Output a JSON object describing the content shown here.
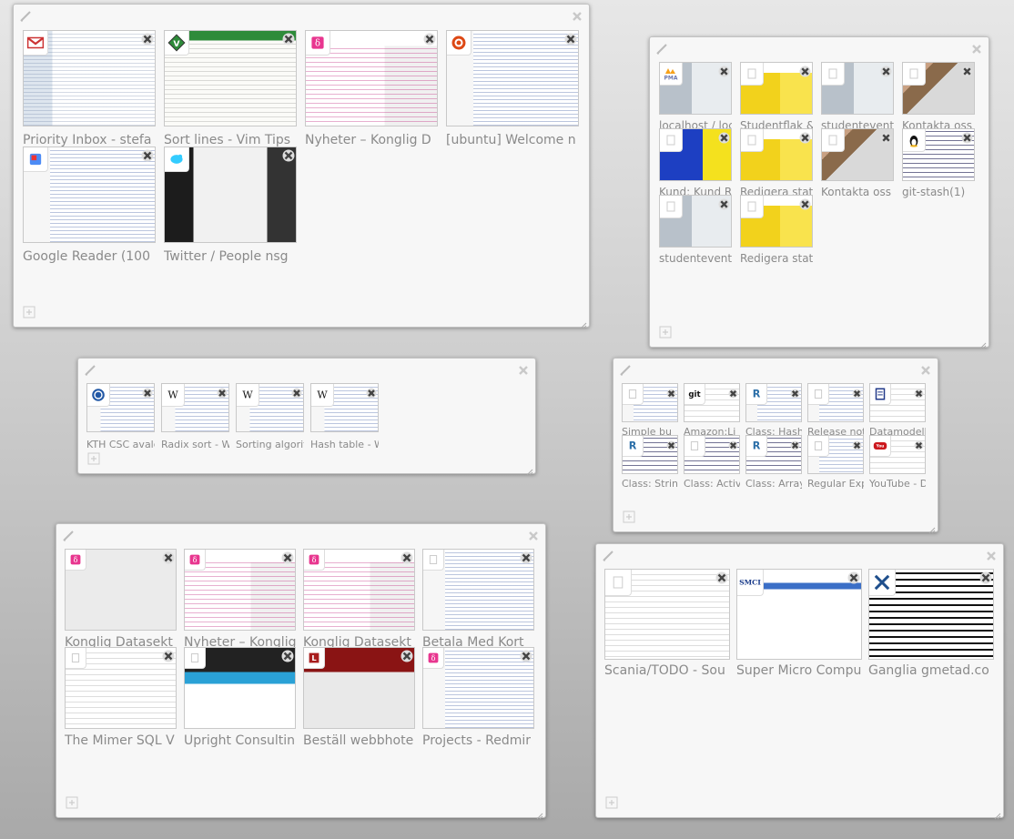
{
  "groups": [
    {
      "id": "group1",
      "tabs": [
        {
          "title": "Priority Inbox - stefa",
          "icon": "gmail-icon",
          "page": "p-table"
        },
        {
          "title": "Sort lines - Vim Tips",
          "icon": "vim-icon",
          "page": "p-green"
        },
        {
          "title": "Nyheter – Konglig D",
          "icon": "datasektionen-icon",
          "page": "p-news"
        },
        {
          "title": "[ubuntu] Welcome n",
          "icon": "ubuntu-icon",
          "page": "p-wiki"
        },
        {
          "title": "Google Reader (100",
          "icon": "google-reader-icon",
          "page": "p-wiki"
        },
        {
          "title": "Twitter / People nsg",
          "icon": "twitter-icon",
          "page": "p-dark"
        }
      ]
    },
    {
      "id": "group2",
      "tabs": [
        {
          "title": "localhost / loca",
          "icon": "phpmyadmin-icon",
          "page": "p-grey"
        },
        {
          "title": "Studentflak & ",
          "icon": "blank-icon",
          "page": "p-yellow"
        },
        {
          "title": "studentevent",
          "icon": "blank-icon",
          "page": "p-grey"
        },
        {
          "title": "Kontakta oss",
          "icon": "blank-icon",
          "page": "p-photo"
        },
        {
          "title": "Kund: Kund R",
          "icon": "blank-icon",
          "page": "p-blueyel"
        },
        {
          "title": "Redigera statu",
          "icon": "blank-icon",
          "page": "p-yellow"
        },
        {
          "title": "Kontakta oss - ",
          "icon": "blank-icon",
          "page": "p-photo"
        },
        {
          "title": "git-stash(1)",
          "icon": "linux-penguin-icon",
          "page": "p-code"
        },
        {
          "title": "studentevent",
          "icon": "blank-icon",
          "page": "p-grey"
        },
        {
          "title": "Redigera statu",
          "icon": "blank-icon",
          "page": "p-yellow"
        }
      ]
    },
    {
      "id": "group3",
      "tabs": [
        {
          "title": "KTH CSC avalc",
          "icon": "kth-icon",
          "page": "p-wiki"
        },
        {
          "title": "Radix sort - Wi",
          "icon": "wikipedia-icon",
          "page": "p-wiki"
        },
        {
          "title": "Sorting algorit",
          "icon": "wikipedia-icon",
          "page": "p-wiki"
        },
        {
          "title": "Hash table - W",
          "icon": "wikipedia-icon",
          "page": "p-wiki"
        }
      ]
    },
    {
      "id": "group4",
      "tabs": [
        {
          "title": "Simple bu",
          "icon": "blank-icon",
          "page": "p-wiki"
        },
        {
          "title": "Amazon:Li",
          "icon": "git-icon",
          "page": "p-plain"
        },
        {
          "title": "Class: Hash",
          "icon": "ruby-doc-icon",
          "page": "p-wiki"
        },
        {
          "title": "Release not",
          "icon": "blank-icon",
          "page": "p-wiki"
        },
        {
          "title": "Datamodell",
          "icon": "notebook-icon",
          "page": "p-plain"
        },
        {
          "title": "Class: String",
          "icon": "ruby-doc-icon",
          "page": "p-code"
        },
        {
          "title": "Class: Active",
          "icon": "blank-icon",
          "page": "p-code"
        },
        {
          "title": "Class: Array",
          "icon": "ruby-doc-icon",
          "page": "p-code"
        },
        {
          "title": "Regular Expre",
          "icon": "blank-icon",
          "page": "p-wiki"
        },
        {
          "title": "YouTube - De",
          "icon": "youtube-icon",
          "page": "p-plain"
        }
      ]
    },
    {
      "id": "group5",
      "tabs": [
        {
          "title": "Konglig Datasekt",
          "icon": "datasektionen-icon",
          "page": "p-dataset"
        },
        {
          "title": "Nyheter – Konglig",
          "icon": "datasektionen-icon",
          "page": "p-news"
        },
        {
          "title": "Konglig Datasekt",
          "icon": "datasektionen-icon",
          "page": "p-news"
        },
        {
          "title": "Betala Med Kort",
          "icon": "blank-icon",
          "page": "p-wiki"
        },
        {
          "title": "The Mimer SQL V",
          "icon": "blank-icon",
          "page": "p-plain"
        },
        {
          "title": "Upright Consultin",
          "icon": "blank-icon",
          "page": "p-upright"
        },
        {
          "title": "Beställ webbhote",
          "icon": "loopia-icon",
          "page": "p-red"
        },
        {
          "title": "Projects - Redmir",
          "icon": "datasektionen-icon",
          "page": "p-wiki"
        }
      ]
    },
    {
      "id": "group6",
      "tabs": [
        {
          "title": "Scania/TODO - Sou",
          "icon": "blank-icon",
          "page": "p-plain"
        },
        {
          "title": "Super Micro Compu",
          "icon": "smci-icon",
          "page": "p-smci"
        },
        {
          "title": "Ganglia gmetad.co",
          "icon": "ganglia-icon",
          "page": "p-black"
        }
      ]
    }
  ]
}
